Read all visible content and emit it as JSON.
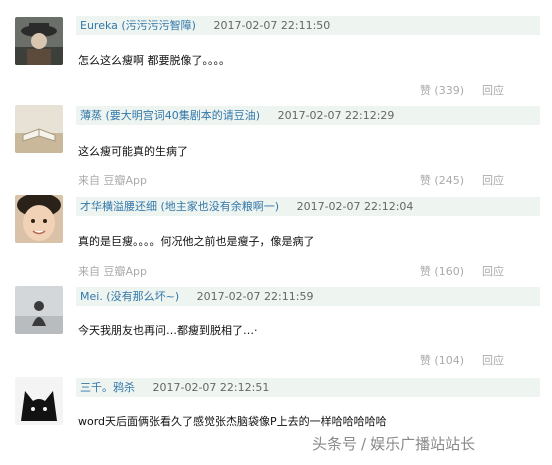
{
  "comments": [
    {
      "author": "Eureka (污污污污智障)",
      "time": "2017-02-07 22:11:50",
      "content": "怎么这么瘦啊 都要脱像了。。。。",
      "from": "",
      "votes": "赞 (339)",
      "reply": "回应",
      "avatar": "user-avatar-hat"
    },
    {
      "author": "薄蒸 (要大明宫词40集剧本的请豆油)",
      "time": "2017-02-07 22:12:29",
      "content": "这么瘦可能真的生病了",
      "from": "来自 豆瓣App",
      "votes": "赞 (245)",
      "reply": "回应",
      "avatar": "user-avatar-book"
    },
    {
      "author": "才华横溢腰还细 (地主家也没有余粮啊一)",
      "time": "2017-02-07 22:12:04",
      "content": "真的是巨瘦。。。。何况他之前也是瘦子，像是病了",
      "from": "来自 豆瓣App",
      "votes": "赞 (160)",
      "reply": "回应",
      "avatar": "user-avatar-child"
    },
    {
      "author": "Mei. (没有那么坏~)",
      "time": "2017-02-07 22:11:59",
      "content": "今天我朋友也再问…都瘦到脱相了…·",
      "from": "",
      "votes": "赞 (104)",
      "reply": "回应",
      "avatar": "user-avatar-silhouette"
    },
    {
      "author": "三千。鸦杀",
      "time": "2017-02-07 22:12:51",
      "content": "word天后面俩张看久了感觉张杰脑袋像P上去的一样哈哈哈哈哈",
      "from": "",
      "votes": "",
      "reply": "",
      "avatar": "user-avatar-cat"
    }
  ],
  "watermark": {
    "source": "头条号",
    "separator": "/",
    "channel": "娱乐广播站站长"
  }
}
